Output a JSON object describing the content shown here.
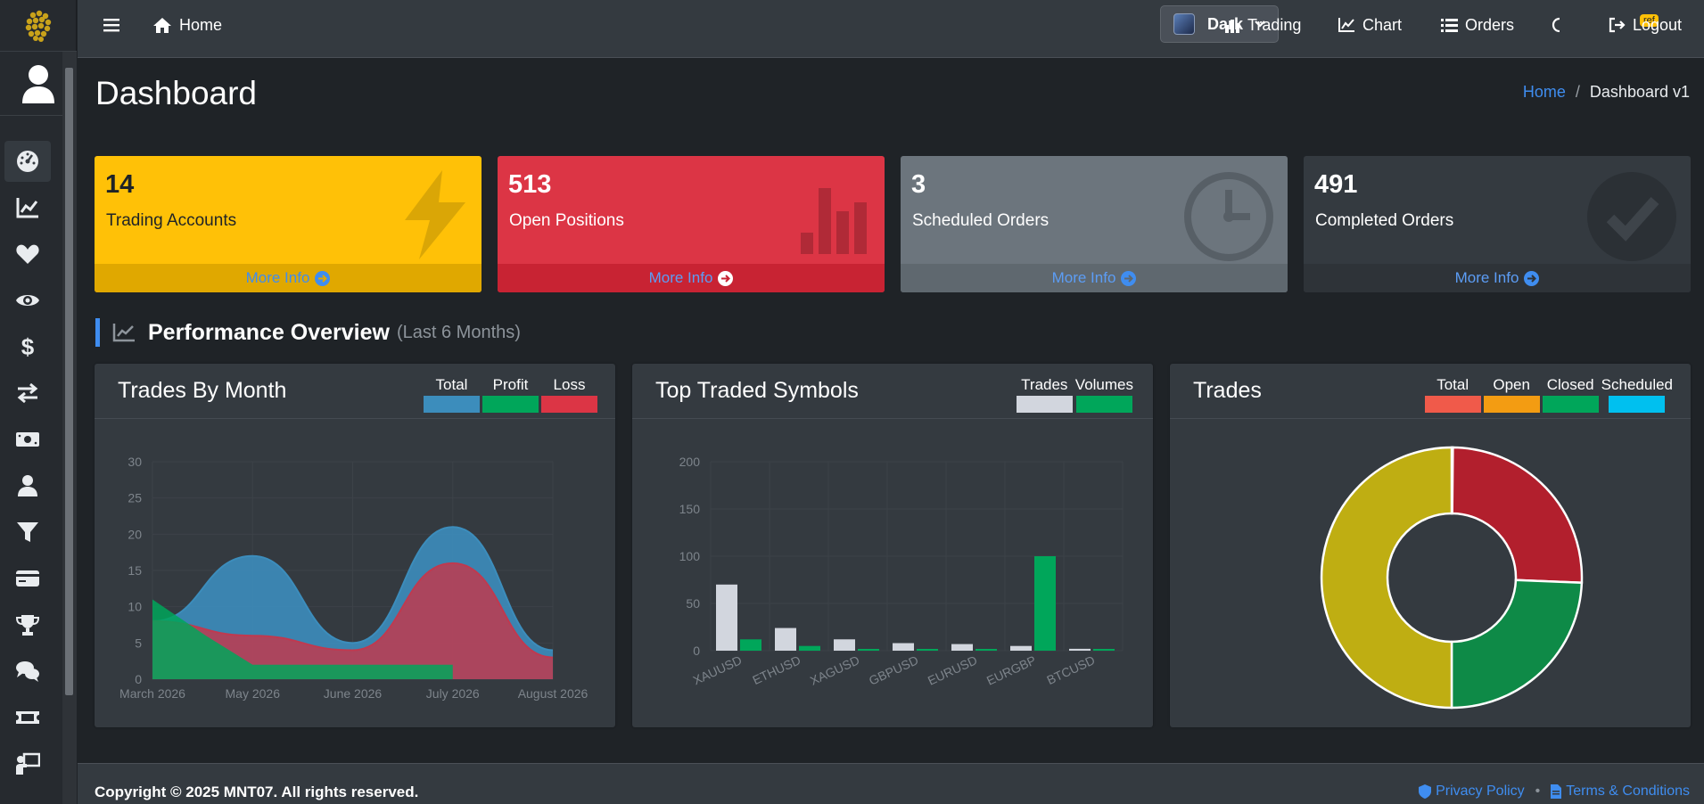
{
  "topbar": {
    "home_label": "Home",
    "theme_label": "Dark",
    "trading_label": "Trading",
    "chart_label": "Chart",
    "orders_label": "Orders",
    "ref_badge": "ref",
    "logout_label": "Logout"
  },
  "sidebar": {
    "items": [
      "dashboard",
      "chart-line",
      "heart",
      "eye",
      "dollar",
      "exchange",
      "money",
      "user",
      "filter",
      "credit-card",
      "trophy",
      "comments",
      "ticket",
      "user-tie"
    ],
    "active": "dashboard"
  },
  "page": {
    "title": "Dashboard",
    "breadcrumb": {
      "home": "Home",
      "sep": "/",
      "current": "Dashboard v1"
    }
  },
  "stats": [
    {
      "value": "14",
      "label": "Trading Accounts",
      "more": "More Info",
      "color": "#ffc107",
      "icon": "bolt-icon"
    },
    {
      "value": "513",
      "label": "Open Positions",
      "more": "More Info",
      "color": "#dc3545",
      "icon": "bar-chart-icon"
    },
    {
      "value": "3",
      "label": "Scheduled Orders",
      "more": "More Info",
      "color": "#6c757d",
      "icon": "clock-icon"
    },
    {
      "value": "491",
      "label": "Completed Orders",
      "more": "More Info",
      "color": "#343a40",
      "icon": "check-circle-icon"
    }
  ],
  "section": {
    "title": "Performance Overview",
    "subtitle": "(Last 6 Months)"
  },
  "cards": {
    "trades_by_month": {
      "title": "Trades By Month",
      "legend": [
        "Total",
        "Profit",
        "Loss"
      ]
    },
    "top_symbols": {
      "title": "Top Traded Symbols",
      "legend": [
        "Trades",
        "Volumes"
      ]
    },
    "trades": {
      "title": "Trades",
      "legend": [
        "Total",
        "Open",
        "Closed",
        "Scheduled"
      ]
    }
  },
  "chart_data": [
    {
      "type": "area",
      "categories": [
        "March 2026",
        "May 2026",
        "June 2026",
        "July 2026",
        "August 2026"
      ],
      "ylim": [
        0,
        30
      ],
      "yticks": [
        0,
        5,
        10,
        15,
        20,
        25,
        30
      ],
      "series": [
        {
          "name": "Total",
          "color": "#3c8dbc",
          "values": [
            8,
            17,
            5,
            21,
            4
          ]
        },
        {
          "name": "Loss",
          "color": "#c0394f",
          "values": [
            8,
            6,
            4,
            16,
            3
          ]
        },
        {
          "name": "Profit",
          "color": "#00a65a",
          "values": [
            11,
            2,
            2,
            2,
            0
          ]
        }
      ]
    },
    {
      "type": "bar",
      "categories": [
        "XAUUSD",
        "ETHUSD",
        "XAGUSD",
        "GBPUSD",
        "EURUSD",
        "EURGBP",
        "BTCUSD"
      ],
      "ylim": [
        0,
        200
      ],
      "yticks": [
        0,
        50,
        100,
        150,
        200
      ],
      "series": [
        {
          "name": "Trades",
          "color": "#d2d6de",
          "values": [
            70,
            24,
            12,
            8,
            7,
            5,
            2
          ]
        },
        {
          "name": "Volumes",
          "color": "#00a65a",
          "values": [
            12,
            5,
            1,
            1,
            1,
            100,
            1
          ]
        }
      ]
    },
    {
      "type": "pie",
      "categories": [
        "Total",
        "Open",
        "Closed",
        "Scheduled"
      ],
      "values": [
        1007,
        513,
        491,
        3
      ],
      "colors": [
        "#bfae12",
        "#b21f2d",
        "#0e8a47",
        "#8fb3c9"
      ]
    }
  ],
  "footer": {
    "copyright": "Copyright © 2025 MNT07. All rights reserved.",
    "privacy": "Privacy Policy",
    "sep": "•",
    "terms": "Terms & Conditions"
  },
  "colors": {
    "accent": "#3f8df0",
    "bg": "#1f2327",
    "card": "#343a40"
  }
}
